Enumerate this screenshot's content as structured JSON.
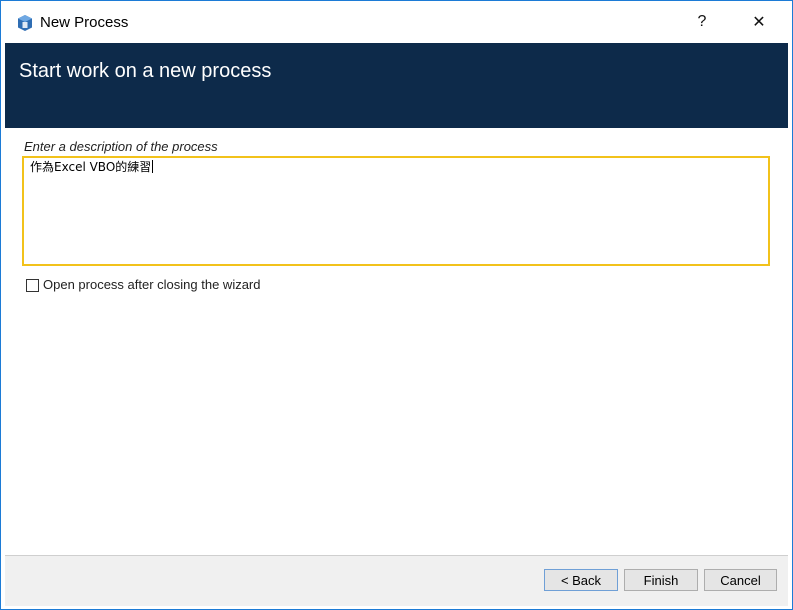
{
  "window": {
    "title": "New Process",
    "help_label": "?",
    "close_label": "✕"
  },
  "header": {
    "title": "Start work on a new process"
  },
  "description": {
    "label": "Enter a description of the process",
    "value": "作為Excel VBO的練習"
  },
  "open_after": {
    "label": "Open process after closing the wizard",
    "checked": false
  },
  "buttons": {
    "back": "< Back",
    "finish": "Finish",
    "cancel": "Cancel"
  },
  "colors": {
    "header_bg": "#0d2a4a",
    "focus_border": "#f2c21b",
    "window_border": "#1c7bd6"
  },
  "icons": {
    "app": "blue-prism-app-icon",
    "help": "question-mark-icon",
    "close": "close-icon"
  }
}
